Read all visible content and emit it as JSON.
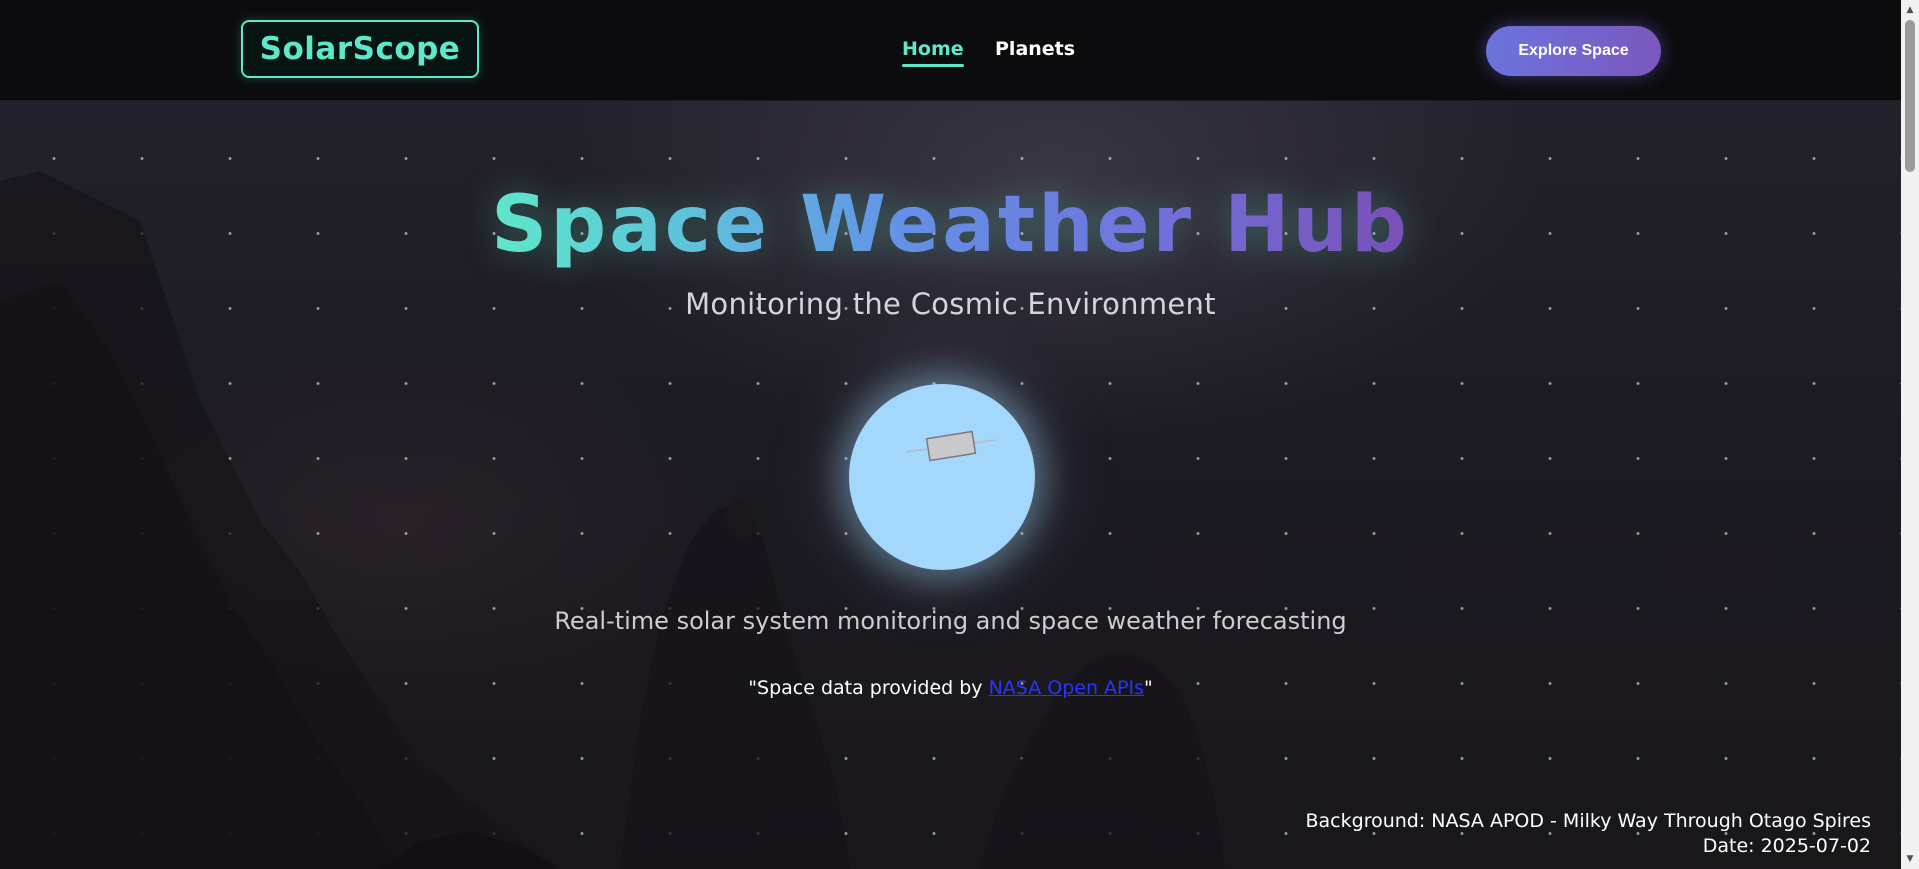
{
  "header": {
    "logo": "SolarScope",
    "nav": [
      {
        "label": "Home",
        "active": true
      },
      {
        "label": "Planets",
        "active": false
      }
    ],
    "cta_label": "Explore Space"
  },
  "hero": {
    "title": "Space Weather Hub",
    "subtitle": "Monitoring the Cosmic Environment",
    "tagline": "Real-time solar system monitoring and space weather forecasting",
    "credit_prefix": "\"Space data provided by ",
    "credit_link": "NASA Open APIs",
    "credit_suffix": "\""
  },
  "background_info": {
    "line1": "Background: NASA APOD - Milky Way Through Otago Spires",
    "line2": "Date: 2025-07-02"
  },
  "colors": {
    "accent": "#5ee7c9",
    "cta_start": "#6b74dc",
    "cta_end": "#7b57bf",
    "planet": "#a3d7fb",
    "link": "#2436ff"
  },
  "icons": {
    "scroll_up": "triangle-up-icon",
    "scroll_down": "triangle-down-icon",
    "satellite": "satellite-icon"
  }
}
